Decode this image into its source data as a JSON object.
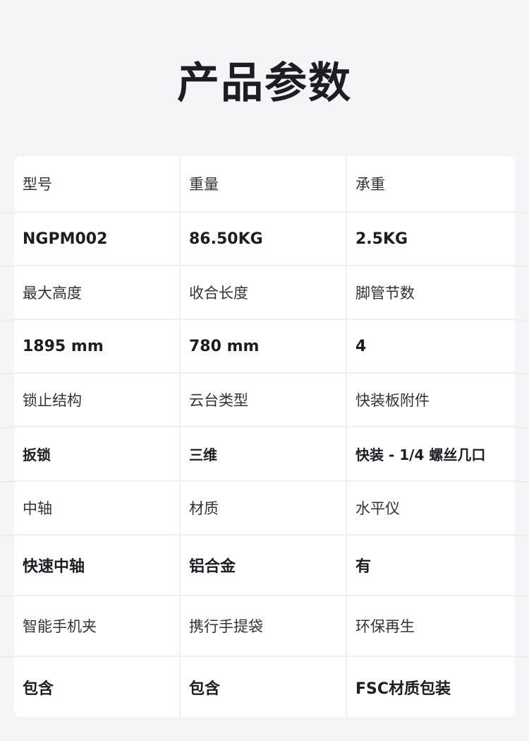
{
  "title": "产品参数",
  "specs": [
    {
      "labels": [
        "型号",
        "重量",
        "承重"
      ],
      "values": [
        "NGPM002",
        "86.50KG",
        "2.5KG"
      ]
    },
    {
      "labels": [
        "最大高度",
        "收合长度",
        "脚管节数"
      ],
      "values": [
        "1895 mm",
        "780 mm",
        "4"
      ]
    },
    {
      "labels": [
        "锁止结构",
        "云台类型",
        "快装板附件"
      ],
      "values": [
        "扳锁",
        "三维",
        "快装 - 1/4 螺丝几口"
      ]
    },
    {
      "labels": [
        "中轴",
        "材质",
        "水平仪"
      ],
      "values": [
        "快速中轴",
        "铝合金",
        "有"
      ]
    },
    {
      "labels": [
        "智能手机夹",
        "携行手提袋",
        "环保再生"
      ],
      "values": [
        "包含",
        "包含",
        "FSC材质包装"
      ]
    }
  ]
}
